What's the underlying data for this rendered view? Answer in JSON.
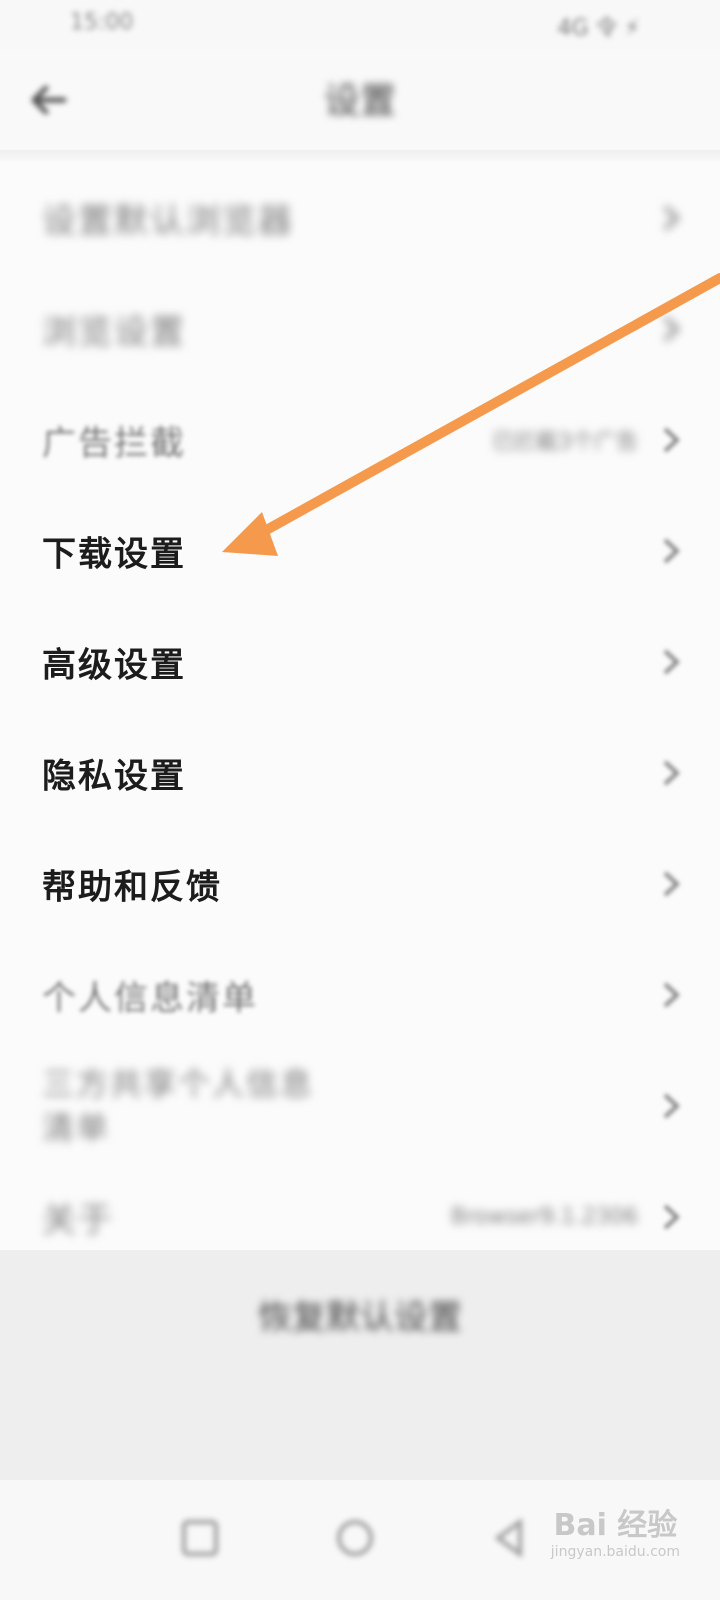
{
  "status_bar": {
    "time": "15:00",
    "indicators": "4G 令 ⚡"
  },
  "header": {
    "title": "设置",
    "back_icon": "back-arrow-icon"
  },
  "settings": [
    {
      "label": "设置默认浏览器",
      "value": "",
      "state": "blurred"
    },
    {
      "label": "浏览设置",
      "value": "",
      "state": "blurred"
    },
    {
      "label": "广告拦截",
      "value": "已拦截3个广告",
      "state": "soft"
    },
    {
      "label": "下载设置",
      "value": "",
      "state": "sharp"
    },
    {
      "label": "高级设置",
      "value": "",
      "state": "sharp"
    },
    {
      "label": "隐私设置",
      "value": "",
      "state": "sharp"
    },
    {
      "label": "帮助和反馈",
      "value": "",
      "state": "sharp"
    },
    {
      "label": "个人信息清单",
      "value": "",
      "state": "soft"
    },
    {
      "label": "三方共享个人信息清单",
      "value": "",
      "state": "blurred"
    },
    {
      "label": "关于",
      "value": "Browser9.1.2306",
      "state": "blurred"
    }
  ],
  "footer": {
    "reset_label": "恢复默认设置"
  },
  "watermark": {
    "logo_text": "Bai 经验",
    "url": "jingyan.baidu.com"
  },
  "colors": {
    "arrow": "#f59a4c",
    "background": "#fbfbfb",
    "footer_bg": "#eeeeee"
  }
}
